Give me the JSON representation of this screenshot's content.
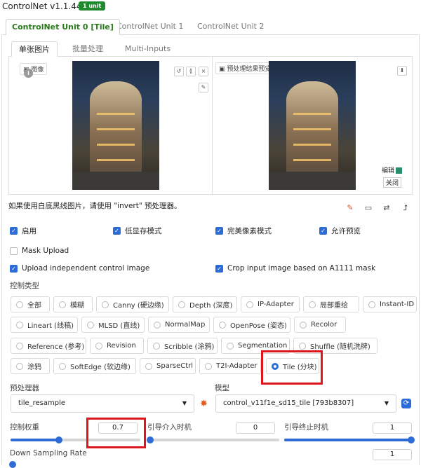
{
  "header": {
    "title": "ControlNet v1.1.444",
    "badge": "1 unit",
    "caret": "▼"
  },
  "unit_tabs": [
    "ControlNet Unit 0 [Tile]",
    "ControlNet Unit 1",
    "ControlNet Unit 2"
  ],
  "image_tabs": [
    "单张图片",
    "批量处理",
    "Multi-Inputs"
  ],
  "left_image": {
    "label": "图像"
  },
  "right_image": {
    "label": "预处理结果预览",
    "edit": "编辑",
    "close": "关闭"
  },
  "invert_note": "如果使用白底黑线图片，请使用 \"invert\" 预处理器。",
  "options": {
    "enable": "启用",
    "low_vram": "低显存模式",
    "pixel_perfect": "完美像素模式",
    "allow_preview": "允许预览",
    "mask_upload": "Mask Upload",
    "upload_independent": "Upload independent control image",
    "crop_input": "Crop input image based on A1111 mask"
  },
  "control_type": {
    "label": "控制类型",
    "selected": "Tile (分块)",
    "items": [
      "全部",
      "模糊",
      "Canny (硬边缘)",
      "Depth (深度)",
      "IP-Adapter",
      "局部重绘",
      "Instant-ID",
      "Lineart (线稿)",
      "MLSD (直线)",
      "NormalMap",
      "OpenPose (姿态)",
      "Recolor",
      "Reference (参考)",
      "Revision",
      "Scribble (涂鸦)",
      "Segmentation",
      "Shuffle (随机洗牌)",
      "涂鸦",
      "SoftEdge (软边缘)",
      "SparseCtrl",
      "T2I-Adapter",
      "Tile (分块)"
    ]
  },
  "preprocessor": {
    "label": "预处理器",
    "value": "tile_resample"
  },
  "model": {
    "label": "模型",
    "value": "control_v11f1e_sd15_tile [793b8307]"
  },
  "sliders": {
    "weight": {
      "label": "控制权重",
      "value": "0.7"
    },
    "start": {
      "label": "引导介入时机",
      "value": "0"
    },
    "end": {
      "label": "引导终止时机",
      "value": "1"
    },
    "downsampling": {
      "label": "Down Sampling Rate",
      "value": "1"
    }
  },
  "icons": {
    "undo": "↺",
    "erase": "⟪",
    "close": "×",
    "pen": "✎",
    "download": "⬇",
    "spark": "✸",
    "refresh": "⟳",
    "swap": "⇄",
    "send": "⮥",
    "camera": "▭",
    "edit": "✎"
  },
  "colors": {
    "accent": "#2d6cd6",
    "badge": "#1f8a2e",
    "highlight": "#e0151b",
    "active_tab": "#2a7a1d"
  }
}
